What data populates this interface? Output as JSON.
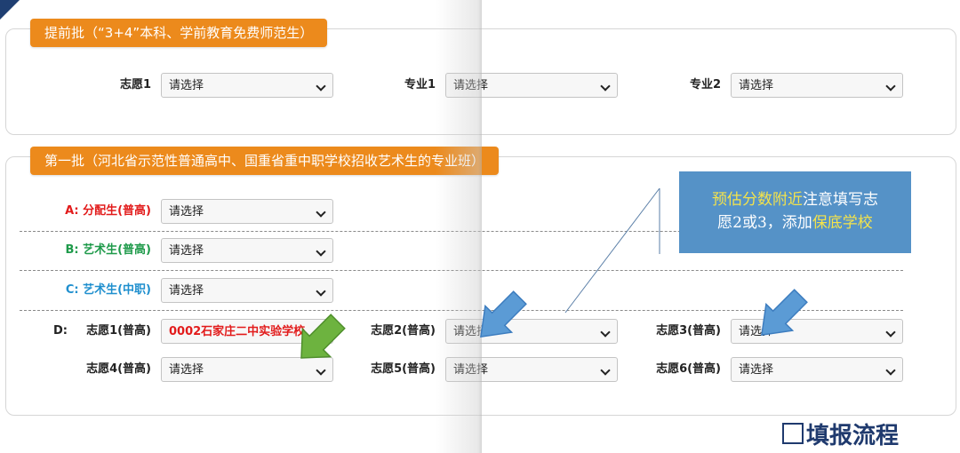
{
  "section1": {
    "title": "提前批（“3+4”本科、学前教育免费师范生）",
    "fields": [
      {
        "label": "志愿1",
        "value": "请选择"
      },
      {
        "label": "专业1",
        "value": "请选择"
      },
      {
        "label": "专业2",
        "value": "请选择"
      }
    ]
  },
  "section2": {
    "title": "第一批（河北省示范性普通高中、国重省重中职学校招收艺术生的专业班）",
    "rowA": {
      "prefix": "A:",
      "label": "分配生(普高)",
      "value": "请选择"
    },
    "rowB": {
      "prefix": "B:",
      "label": "艺术生(普高)",
      "value": "请选择"
    },
    "rowC": {
      "prefix": "C:",
      "label": "艺术生(中职)",
      "value": "请选择"
    },
    "rowD": {
      "prefix": "D:",
      "items": [
        {
          "label": "志愿1(普高)",
          "value": "0002石家庄二中实验学校"
        },
        {
          "label": "志愿2(普高)",
          "value": "请选择"
        },
        {
          "label": "志愿3(普高)",
          "value": "请选择"
        },
        {
          "label": "志愿4(普高)",
          "value": "请选择"
        },
        {
          "label": "志愿5(普高)",
          "value": "请选择"
        },
        {
          "label": "志愿6(普高)",
          "value": "请选择"
        }
      ]
    }
  },
  "callout": {
    "part1_highlight": "预估分数附近",
    "part2": "注意填写志",
    "part3": "愿2或3，添加",
    "part4_highlight": "保底学校"
  },
  "footer": {
    "title": "填报流程"
  },
  "colors": {
    "section_title_bg": "#ec8a1c",
    "label_a": "#e21b1b",
    "label_b": "#1e9a4a",
    "label_c": "#1f8fce",
    "callout_bg": "#5592c7",
    "callout_highlight": "#f4e34b",
    "green_arrow": "#6db33f",
    "blue_arrow": "#5b9bd5"
  }
}
